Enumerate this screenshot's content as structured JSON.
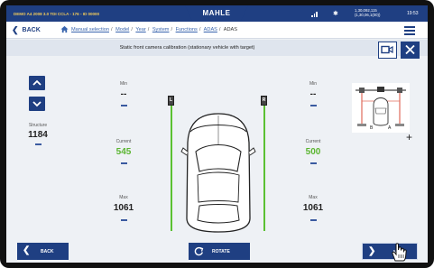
{
  "status_bar": {
    "vehicle": "DEMO A4 2008 3.0 TDI CCLA - 176 - ID 00000",
    "brand": "MAHLE",
    "phone_line1": "1,30,092,115",
    "phone_line2": "(1,30,06,1(00))",
    "time": "19:53"
  },
  "nav": {
    "back_label": "BACK",
    "breadcrumbs": [
      "Manual selection",
      "Model",
      "Year",
      "System",
      "Functions",
      "ADAS",
      "ADAS"
    ]
  },
  "title": "Static front camera calibration (stationary vehicle with target)",
  "left_panel": {
    "structure_label": "Structure",
    "structure_value": "1184"
  },
  "left_gauge": {
    "min_label": "Min",
    "min_value": "--",
    "current_label": "Current",
    "current_value": "545",
    "max_label": "Max",
    "max_value": "1061"
  },
  "right_gauge": {
    "min_label": "Min",
    "min_value": "--",
    "current_label": "Current",
    "current_value": "500",
    "max_label": "Max",
    "max_value": "1061"
  },
  "targets": {
    "left": "L",
    "right": "R"
  },
  "mini_diagram": {
    "label_b": "B",
    "label_a": "A"
  },
  "add_symbol": "+",
  "bottom": {
    "back_label": "BACK",
    "rotate_label": "ROTATE",
    "next_label": "NEXT"
  },
  "colors": {
    "brand_blue": "#1f3f82",
    "current_green": "#5bb531",
    "rail_green": "#5bc132",
    "panel_bg": "#eef1f5"
  }
}
